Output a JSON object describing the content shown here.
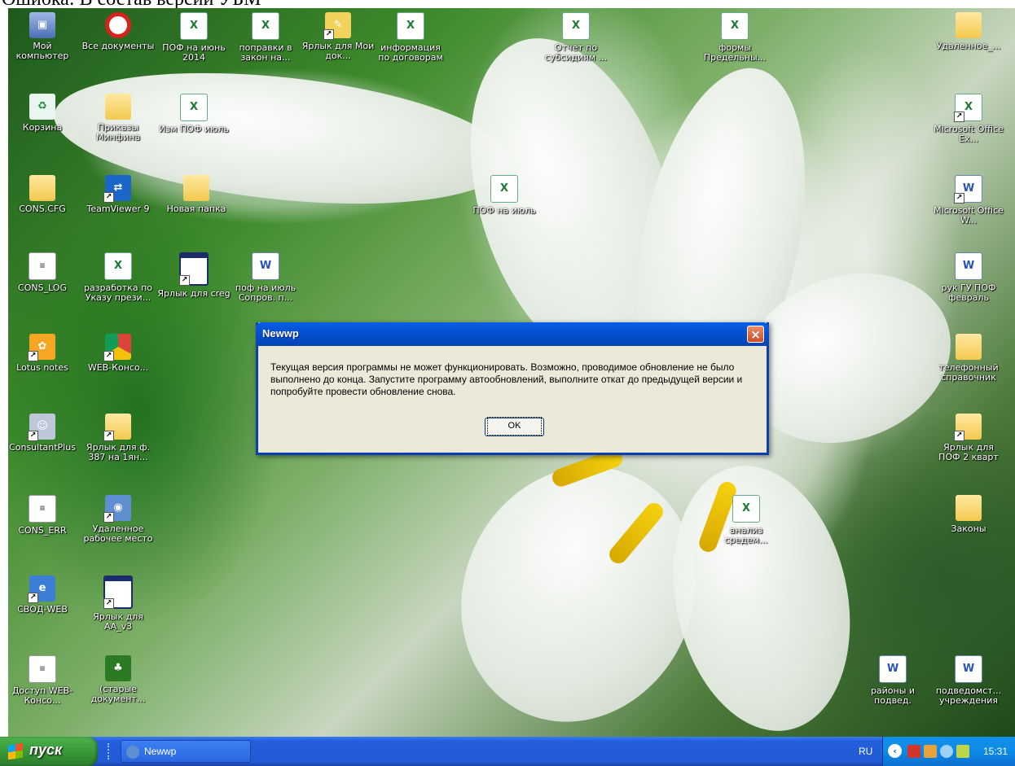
{
  "top_caption": "Ошибка: В состав версии УБМ",
  "desktop_icons": [
    {
      "label": "Мой компьютер",
      "icon": "computer-icon"
    },
    {
      "label": "Все документы",
      "icon": "no-entry-icon"
    },
    {
      "label": "ПОФ на июнь 2014",
      "icon": "excel-file-icon"
    },
    {
      "label": "поправки в закон на...",
      "icon": "excel-file-icon"
    },
    {
      "label": "Ярлык для Мои док...",
      "icon": "pencil-shortcut-icon"
    },
    {
      "label": "информация по договорам",
      "icon": "excel-file-icon"
    },
    {
      "label": "Отчет по субсидиям ...",
      "icon": "excel-file-icon"
    },
    {
      "label": "формы Предельны...",
      "icon": "excel-file-icon"
    },
    {
      "label": "Удаленное_...",
      "icon": "folder-icon"
    },
    {
      "label": "Корзина",
      "icon": "recycle-bin-icon"
    },
    {
      "label": "Приказы Минфина",
      "icon": "folder-icon"
    },
    {
      "label": "Изм ПОФ июль",
      "icon": "excel-file-icon"
    },
    {
      "label": "Microsoft Office Ex...",
      "icon": "excel-shortcut-icon"
    },
    {
      "label": "CONS.CFG",
      "icon": "folder-icon"
    },
    {
      "label": "TeamViewer 9",
      "icon": "teamviewer-icon"
    },
    {
      "label": "Новая папка",
      "icon": "folder-icon"
    },
    {
      "label": "ПОФ на июль",
      "icon": "excel-file-icon"
    },
    {
      "label": "Microsoft Office W...",
      "icon": "word-shortcut-icon"
    },
    {
      "label": "CONS_LOG",
      "icon": "text-file-icon"
    },
    {
      "label": "разработка по Указу прези...",
      "icon": "excel-file-icon"
    },
    {
      "label": "Ярлык для creg",
      "icon": "app-window-icon"
    },
    {
      "label": "поф на июль Сопров. п...",
      "icon": "word-file-icon"
    },
    {
      "label": "рук ГУ ПОФ февраль",
      "icon": "word-file-icon"
    },
    {
      "label": "Lotus notes",
      "icon": "lotus-icon"
    },
    {
      "label": "WEB-Консо...",
      "icon": "chrome-icon"
    },
    {
      "label": "телефонный справочник",
      "icon": "folder-icon"
    },
    {
      "label": "ConsultantPlus",
      "icon": "consultant-icon"
    },
    {
      "label": "Ярлык для ф. 387 на 1ян...",
      "icon": "folder-shortcut-icon"
    },
    {
      "label": "Ярлык для ПОФ 2 кварт",
      "icon": "folder-shortcut-icon"
    },
    {
      "label": "CONS_ERR",
      "icon": "text-file-icon"
    },
    {
      "label": "Удаленное рабочее место",
      "icon": "remote-desktop-icon"
    },
    {
      "label": "анализ средем...",
      "icon": "excel-file-icon"
    },
    {
      "label": "Законы",
      "icon": "folder-icon"
    },
    {
      "label": "СВОД-WEB",
      "icon": "ie-icon"
    },
    {
      "label": "Ярлык для AA_v3",
      "icon": "app-window-icon"
    },
    {
      "label": "Доступ WEB-Консо...",
      "icon": "text-file-icon"
    },
    {
      "label": "(старые документ...",
      "icon": "tree-icon"
    },
    {
      "label": "районы и подвед.",
      "icon": "word-file-icon"
    },
    {
      "label": "подведомст... учреждения",
      "icon": "word-file-icon"
    }
  ],
  "dialog": {
    "title": "Newwp",
    "close": "×",
    "message": "Текущая версия программы не может функционировать. Возможно, проводимое обновление не было выполнено до конца. Запустите программу автообновлений, выполните откат до предыдущей версии и попробуйте провести обновление снова.",
    "ok_label": "OK"
  },
  "taskbar": {
    "start_label": "пуск",
    "task_label": "Newwp",
    "language": "RU",
    "tray_chevron": "‹",
    "clock": "15:31"
  }
}
